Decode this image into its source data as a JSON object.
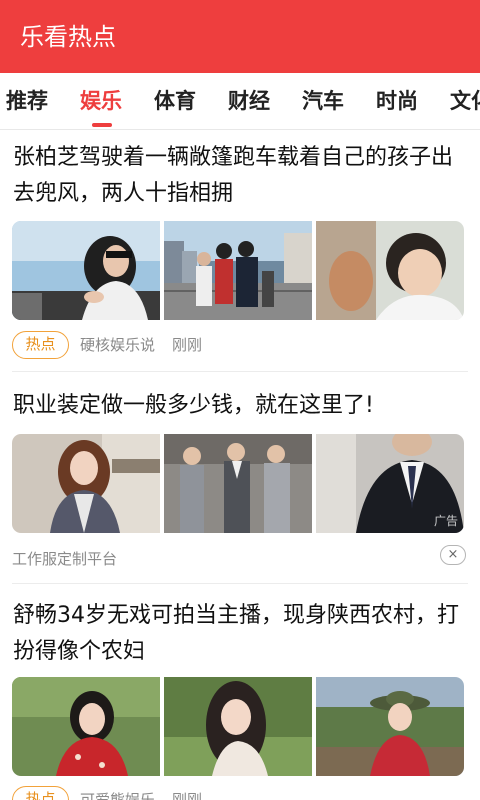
{
  "app": {
    "title": "乐看热点",
    "accent_color": "#ee3e3e"
  },
  "tabs": [
    {
      "label": "推荐",
      "active": false
    },
    {
      "label": "娱乐",
      "active": true
    },
    {
      "label": "体育",
      "active": false
    },
    {
      "label": "财经",
      "active": false
    },
    {
      "label": "汽车",
      "active": false
    },
    {
      "label": "时尚",
      "active": false
    },
    {
      "label": "文化",
      "active": false
    }
  ],
  "articles": [
    {
      "title": "张柏芝驾驶着一辆敞篷跑车载着自己的孩子出去兜风，两人十指相拥",
      "badge": "热点",
      "source": "硬核娱乐说",
      "time": "刚刚",
      "images": [
        "woman-in-convertible-photo",
        "group-on-rooftop-photo",
        "boy-in-car-photo"
      ]
    },
    {
      "title": "职业装定做一般多少钱，就在这里了!",
      "source": "工作服定制平台",
      "ad_mark": "广告",
      "dismiss_icon": "×",
      "images": [
        "woman-in-plaid-suit-photo",
        "men-in-grey-suits-photo",
        "man-in-black-suit-photo"
      ]
    },
    {
      "title": "舒畅34岁无戏可拍当主播，现身陕西农村，打扮得像个农妇",
      "badge": "热点",
      "source": "可爱熊娱乐",
      "time": "刚刚",
      "images": [
        "woman-red-dress-photo",
        "woman-long-hair-photo",
        "woman-in-hat-photo"
      ]
    }
  ]
}
